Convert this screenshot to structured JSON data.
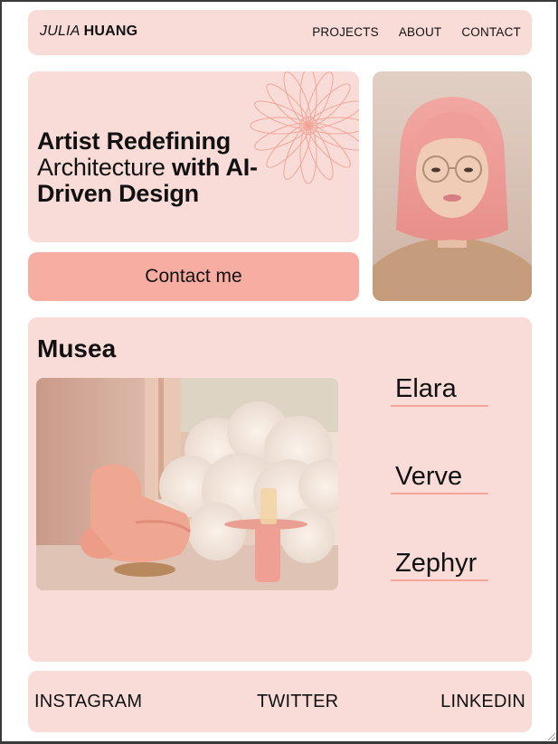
{
  "header": {
    "logo_first": "JULIA",
    "logo_last": "HUANG",
    "nav": [
      "PROJECTS",
      "ABOUT",
      "CONTACT"
    ]
  },
  "hero": {
    "line1": "Artist Redefining",
    "line2_light": "Architecture ",
    "line2_bold": "with AI-",
    "line3": "Driven Design"
  },
  "cta": {
    "label": "Contact me"
  },
  "musea": {
    "title": "Musea",
    "projects": [
      "Elara",
      "Verve",
      "Zephyr"
    ]
  },
  "footer": {
    "links": [
      "INSTAGRAM",
      "TWITTER",
      "LINKEDIN"
    ]
  },
  "colors": {
    "card": "#f9dcd7",
    "accent": "#f8ada2",
    "underline": "#f3a598"
  }
}
